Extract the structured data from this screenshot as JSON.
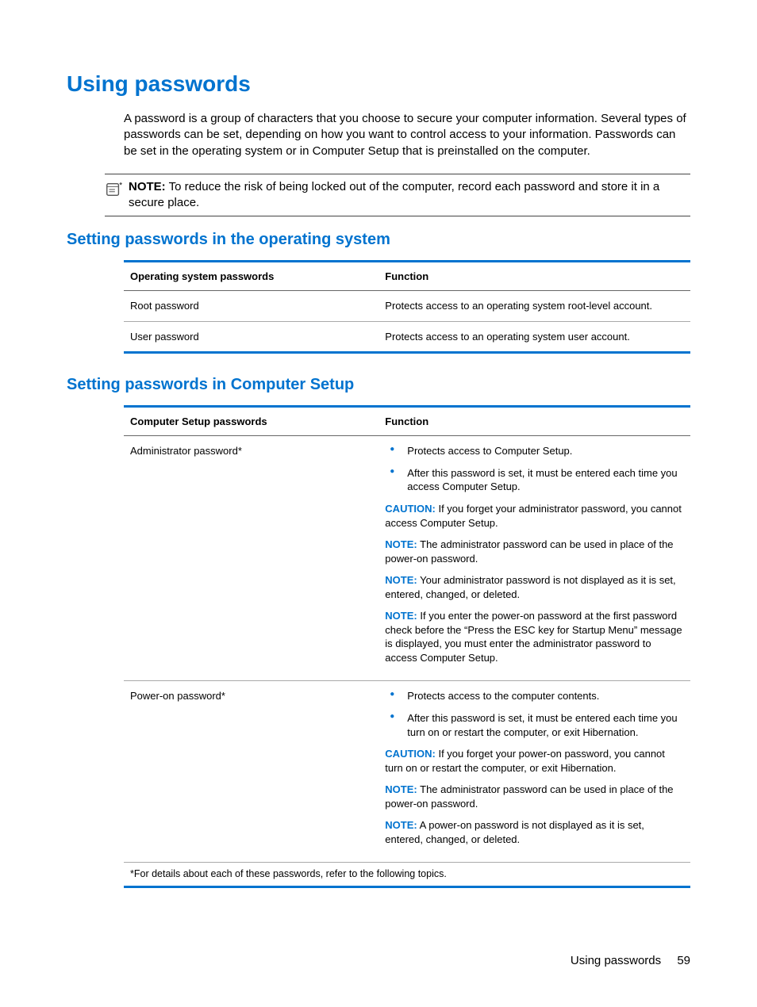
{
  "heading": "Using passwords",
  "intro": "A password is a group of characters that you choose to secure your computer information. Several types of passwords can be set, depending on how you want to control access to your information. Passwords can be set in the operating system or in Computer Setup that is preinstalled on the computer.",
  "topNote": {
    "prefix": "NOTE:",
    "text": "To reduce the risk of being locked out of the computer, record each password and store it in a secure place."
  },
  "osSection": {
    "heading": "Setting passwords in the operating system",
    "header": {
      "col1": "Operating system passwords",
      "col2": "Function"
    },
    "rows": [
      {
        "name": "Root password",
        "func": "Protects access to an operating system root-level account."
      },
      {
        "name": "User password",
        "func": "Protects access to an operating system user account."
      }
    ]
  },
  "csSection": {
    "heading": "Setting passwords in Computer Setup",
    "header": {
      "col1": "Computer Setup passwords",
      "col2": "Function"
    },
    "rows": [
      {
        "name": "Administrator password*",
        "bullets": [
          "Protects access to Computer Setup.",
          "After this password is set, it must be entered each time you access Computer Setup."
        ],
        "callouts": [
          {
            "label": "CAUTION:",
            "text": "If you forget your administrator password, you cannot access Computer Setup."
          },
          {
            "label": "NOTE:",
            "text": "The administrator password can be used in place of the power-on password."
          },
          {
            "label": "NOTE:",
            "text": "Your administrator password is not displayed as it is set, entered, changed, or deleted."
          },
          {
            "label": "NOTE:",
            "text": "If you enter the power-on password at the first password check before the “Press the ESC key for Startup Menu” message is displayed, you must enter the administrator password to access Computer Setup."
          }
        ]
      },
      {
        "name": "Power-on password*",
        "bullets": [
          "Protects access to the computer contents.",
          "After this password is set, it must be entered each time you turn on or restart the computer, or exit Hibernation."
        ],
        "callouts": [
          {
            "label": "CAUTION:",
            "text": "If you forget your power-on password, you cannot turn on or restart the computer, or exit Hibernation."
          },
          {
            "label": "NOTE:",
            "text": "The administrator password can be used in place of the power-on password."
          },
          {
            "label": "NOTE:",
            "text": "A power-on password is not displayed as it is set, entered, changed, or deleted."
          }
        ]
      }
    ],
    "footnote": "*For details about each of these passwords, refer to the following topics."
  },
  "footer": {
    "title": "Using passwords",
    "page": "59"
  }
}
